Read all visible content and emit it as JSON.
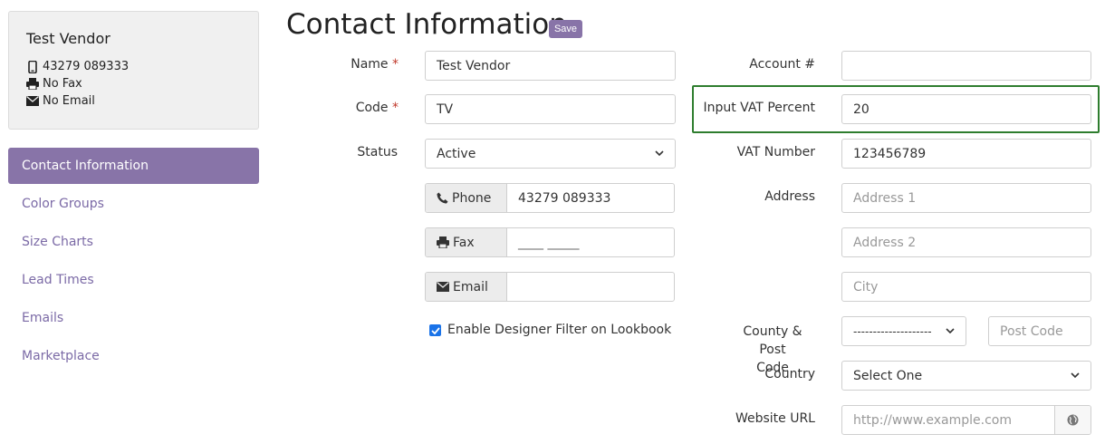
{
  "vendor": {
    "name": "Test Vendor",
    "phone": "43279 089333",
    "fax": "No Fax",
    "email": "No Email"
  },
  "sidebar": {
    "items": [
      {
        "label": "Contact Information",
        "active": true
      },
      {
        "label": "Color Groups"
      },
      {
        "label": "Size Charts"
      },
      {
        "label": "Lead Times"
      },
      {
        "label": "Emails"
      },
      {
        "label": "Marketplace"
      }
    ]
  },
  "header": {
    "title": "Contact Information",
    "save_label": "Save"
  },
  "form": {
    "name_label": "Name",
    "name_value": "Test Vendor",
    "code_label": "Code",
    "code_value": "TV",
    "required_mark": "*",
    "status_label": "Status",
    "status_value": "Active",
    "phone_addon": "Phone",
    "phone_value": "43279 089333",
    "fax_addon": "Fax",
    "fax_placeholder": "____ _____",
    "email_addon": "Email",
    "email_value": "",
    "designer_filter_label": "Enable Designer Filter on Lookbook",
    "designer_filter_checked": true,
    "account_label": "Account #",
    "account_value": "",
    "vat_percent_label": "Input VAT Percent",
    "vat_percent_value": "20",
    "vat_number_label": "VAT Number",
    "vat_number_value": "123456789",
    "address_label": "Address",
    "address1_placeholder": "Address 1",
    "address2_placeholder": "Address 2",
    "city_placeholder": "City",
    "county_post_label_1": "County & Post",
    "county_post_label_2": "Code",
    "county_value": "--------------------",
    "postcode_placeholder": "Post Code",
    "country_label": "Country",
    "country_value": "Select One",
    "website_label": "Website URL",
    "website_placeholder": "http://www.example.com"
  },
  "colors": {
    "accent": "#8874a8",
    "highlight": "#2e7d2e",
    "required": "#c0392b"
  }
}
